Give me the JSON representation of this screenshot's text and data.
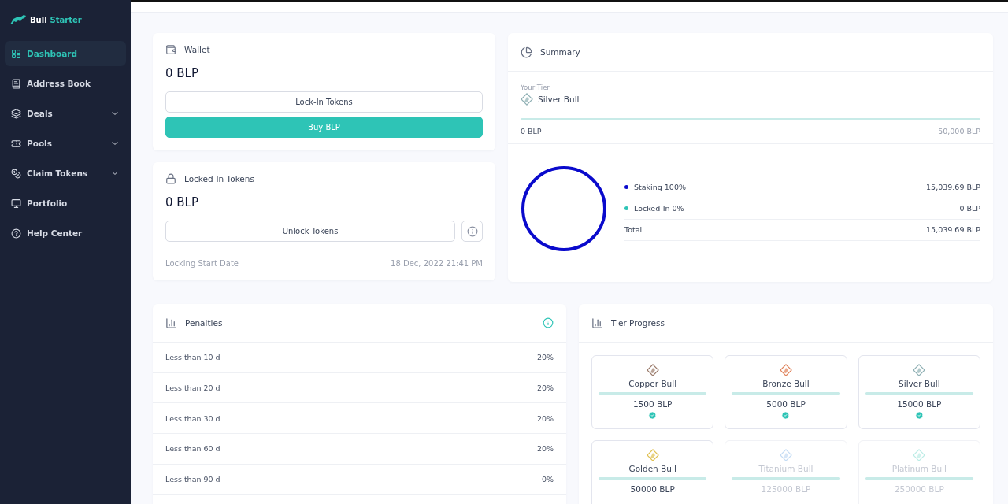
{
  "brand": {
    "first": "Bull",
    "second": "Starter"
  },
  "sidebar": {
    "items": [
      {
        "label": "Dashboard",
        "kind": "link",
        "selected": true
      },
      {
        "label": "Address Book",
        "kind": "link",
        "selected": false
      },
      {
        "label": "Deals",
        "kind": "group",
        "selected": false
      },
      {
        "label": "Pools",
        "kind": "group",
        "selected": false
      },
      {
        "label": "Claim Tokens",
        "kind": "group",
        "selected": false
      },
      {
        "label": "Portfolio",
        "kind": "link",
        "selected": false
      },
      {
        "label": "Help Center",
        "kind": "link",
        "selected": false
      }
    ]
  },
  "wallet": {
    "title": "Wallet",
    "amount": "0 BLP",
    "buttons": [
      {
        "label": "Lock-In Tokens",
        "kind": "outline"
      },
      {
        "label": "Buy BLP",
        "kind": "primary"
      }
    ]
  },
  "locked": {
    "title": "Locked-In Tokens",
    "amount": "0 BLP",
    "button": "Unlock Tokens",
    "date_label": "Locking Start Date",
    "date": "18 Dec, 2022 21:41 PM"
  },
  "summary": {
    "title": "Summary",
    "tier_label": "Your Tier",
    "tier": "Silver Bull",
    "range_start": "0 BLP",
    "range_end": "50,000 BLP",
    "legend": [
      {
        "label": "Staking 100%",
        "value": "15,039.69 BLP",
        "color": "#0a0acc",
        "link": true
      },
      {
        "label": "Locked-In 0%",
        "value": "0 BLP",
        "color": "#2ec4b6",
        "link": false
      }
    ],
    "total_label": "Total",
    "total_value": "15,039.69 BLP"
  },
  "penalties": {
    "title": "Penalties",
    "rows": [
      {
        "period": "Less than 10 d",
        "rate": "20%"
      },
      {
        "period": "Less than 20 d",
        "rate": "20%"
      },
      {
        "period": "Less than 30 d",
        "rate": "20%"
      },
      {
        "period": "Less than 60 d",
        "rate": "20%"
      },
      {
        "period": "Less than 90 d",
        "rate": "0%"
      }
    ]
  },
  "tier_progress": {
    "title": "Tier Progress",
    "tiers": [
      {
        "name": "Copper Bull",
        "amount": "1500 BLP",
        "color": "#9a7a6a",
        "achieved": true,
        "locked": false
      },
      {
        "name": "Bronze Bull",
        "amount": "5000 BLP",
        "color": "#e0825a",
        "achieved": true,
        "locked": false
      },
      {
        "name": "Silver Bull",
        "amount": "15000 BLP",
        "color": "#8fb0b4",
        "achieved": true,
        "locked": false
      },
      {
        "name": "Golden Bull",
        "amount": "50000 BLP",
        "color": "#e0c050",
        "achieved": false,
        "locked": false
      },
      {
        "name": "Titanium Bull",
        "amount": "125000 BLP",
        "color": "#c4dcf4",
        "achieved": false,
        "locked": true
      },
      {
        "name": "Platinum Bull",
        "amount": "250000 BLP",
        "color": "#bcece6",
        "achieved": false,
        "locked": true
      }
    ]
  }
}
